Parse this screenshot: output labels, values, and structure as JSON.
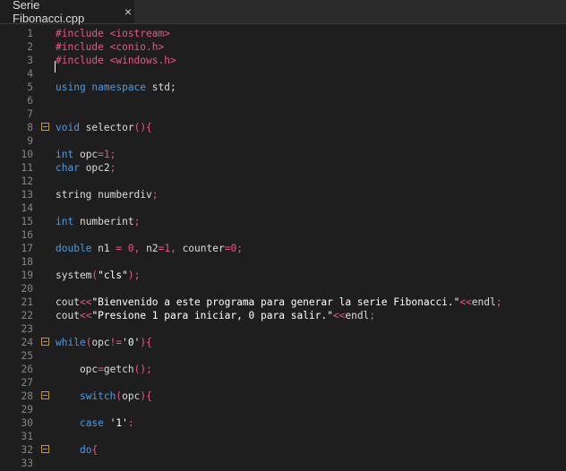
{
  "tab": {
    "title": "Serie Fibonacci.cpp",
    "close_icon": "×"
  },
  "lines": [
    {
      "n": "1",
      "fold": false,
      "tokens": [
        {
          "t": "#include <iostream>",
          "c": "pre"
        }
      ]
    },
    {
      "n": "2",
      "fold": false,
      "tokens": [
        {
          "t": "#include <conio.h>",
          "c": "pre"
        }
      ]
    },
    {
      "n": "3",
      "fold": false,
      "tokens": [
        {
          "t": "#include <windows.h>",
          "c": "pre"
        }
      ]
    },
    {
      "n": "4",
      "fold": false,
      "tokens": []
    },
    {
      "n": "5",
      "fold": false,
      "tokens": [
        {
          "t": "using namespace",
          "c": "kw"
        },
        {
          "t": " std;",
          "c": "txt"
        }
      ]
    },
    {
      "n": "6",
      "fold": false,
      "tokens": []
    },
    {
      "n": "7",
      "fold": false,
      "tokens": []
    },
    {
      "n": "8",
      "fold": true,
      "tokens": [
        {
          "t": "void",
          "c": "kw"
        },
        {
          "t": " selector",
          "c": "txt"
        },
        {
          "t": "(){",
          "c": "op"
        }
      ]
    },
    {
      "n": "9",
      "fold": false,
      "tokens": []
    },
    {
      "n": "10",
      "fold": false,
      "tokens": [
        {
          "t": "int",
          "c": "kw"
        },
        {
          "t": " opc",
          "c": "txt"
        },
        {
          "t": "=",
          "c": "op"
        },
        {
          "t": "1",
          "c": "num"
        },
        {
          "t": ";",
          "c": "op"
        }
      ]
    },
    {
      "n": "11",
      "fold": false,
      "tokens": [
        {
          "t": "char",
          "c": "kw"
        },
        {
          "t": " opc2",
          "c": "txt"
        },
        {
          "t": ";",
          "c": "op"
        }
      ]
    },
    {
      "n": "12",
      "fold": false,
      "tokens": []
    },
    {
      "n": "13",
      "fold": false,
      "tokens": [
        {
          "t": "string numberdiv",
          "c": "txt"
        },
        {
          "t": ";",
          "c": "op"
        }
      ]
    },
    {
      "n": "14",
      "fold": false,
      "tokens": []
    },
    {
      "n": "15",
      "fold": false,
      "tokens": [
        {
          "t": "int",
          "c": "kw"
        },
        {
          "t": " numberint",
          "c": "txt"
        },
        {
          "t": ";",
          "c": "op"
        }
      ]
    },
    {
      "n": "16",
      "fold": false,
      "tokens": []
    },
    {
      "n": "17",
      "fold": false,
      "tokens": [
        {
          "t": "double",
          "c": "kw"
        },
        {
          "t": " n1 ",
          "c": "txt"
        },
        {
          "t": "=",
          "c": "op"
        },
        {
          "t": " 0",
          "c": "num"
        },
        {
          "t": ",",
          "c": "op"
        },
        {
          "t": " n2",
          "c": "txt"
        },
        {
          "t": "=",
          "c": "op"
        },
        {
          "t": "1",
          "c": "num"
        },
        {
          "t": ",",
          "c": "op"
        },
        {
          "t": " counter",
          "c": "txt"
        },
        {
          "t": "=",
          "c": "op"
        },
        {
          "t": "0",
          "c": "num"
        },
        {
          "t": ";",
          "c": "op"
        }
      ]
    },
    {
      "n": "18",
      "fold": false,
      "tokens": []
    },
    {
      "n": "19",
      "fold": false,
      "tokens": [
        {
          "t": "system",
          "c": "txt"
        },
        {
          "t": "(",
          "c": "op"
        },
        {
          "t": "\"cls\"",
          "c": "str"
        },
        {
          "t": ");",
          "c": "op"
        }
      ]
    },
    {
      "n": "20",
      "fold": false,
      "tokens": []
    },
    {
      "n": "21",
      "fold": false,
      "tokens": [
        {
          "t": "cout",
          "c": "txt"
        },
        {
          "t": "<<",
          "c": "op"
        },
        {
          "t": "\"Bienvenido a este programa para generar la serie Fibonacci.\"",
          "c": "str"
        },
        {
          "t": "<<",
          "c": "op"
        },
        {
          "t": "endl",
          "c": "txt"
        },
        {
          "t": ";",
          "c": "op"
        }
      ]
    },
    {
      "n": "22",
      "fold": false,
      "tokens": [
        {
          "t": "cout",
          "c": "txt"
        },
        {
          "t": "<<",
          "c": "op"
        },
        {
          "t": "\"Presione 1 para iniciar, 0 para salir.\"",
          "c": "str"
        },
        {
          "t": "<<",
          "c": "op"
        },
        {
          "t": "endl",
          "c": "txt"
        },
        {
          "t": ";",
          "c": "op"
        }
      ]
    },
    {
      "n": "23",
      "fold": false,
      "tokens": []
    },
    {
      "n": "24",
      "fold": true,
      "tokens": [
        {
          "t": "while",
          "c": "kw"
        },
        {
          "t": "(",
          "c": "op"
        },
        {
          "t": "opc",
          "c": "txt"
        },
        {
          "t": "!=",
          "c": "op"
        },
        {
          "t": "'0'",
          "c": "str"
        },
        {
          "t": "){",
          "c": "op"
        }
      ]
    },
    {
      "n": "25",
      "fold": false,
      "tokens": []
    },
    {
      "n": "26",
      "fold": false,
      "tokens": [
        {
          "t": "    opc",
          "c": "txt"
        },
        {
          "t": "=",
          "c": "op"
        },
        {
          "t": "getch",
          "c": "txt"
        },
        {
          "t": "();",
          "c": "op"
        }
      ]
    },
    {
      "n": "27",
      "fold": false,
      "tokens": []
    },
    {
      "n": "28",
      "fold": true,
      "tokens": [
        {
          "t": "    ",
          "c": "txt"
        },
        {
          "t": "switch",
          "c": "kw"
        },
        {
          "t": "(",
          "c": "op"
        },
        {
          "t": "opc",
          "c": "txt"
        },
        {
          "t": "){",
          "c": "op"
        }
      ]
    },
    {
      "n": "29",
      "fold": false,
      "tokens": []
    },
    {
      "n": "30",
      "fold": false,
      "tokens": [
        {
          "t": "    ",
          "c": "txt"
        },
        {
          "t": "case",
          "c": "kw"
        },
        {
          "t": " ",
          "c": "txt"
        },
        {
          "t": "'1'",
          "c": "str"
        },
        {
          "t": ":",
          "c": "op"
        }
      ]
    },
    {
      "n": "31",
      "fold": false,
      "tokens": []
    },
    {
      "n": "32",
      "fold": true,
      "tokens": [
        {
          "t": "    ",
          "c": "txt"
        },
        {
          "t": "do",
          "c": "kw"
        },
        {
          "t": "{",
          "c": "op"
        }
      ]
    },
    {
      "n": "33",
      "fold": false,
      "tokens": []
    }
  ],
  "colors": {
    "background": "#1e1e1e",
    "preprocessor": "#e8568b",
    "keyword": "#4a9be8",
    "number": "#e8568b",
    "string": "#ffffff",
    "text": "#dcdcdc",
    "fold_marker": "#c89a2a",
    "line_number": "#858585"
  }
}
